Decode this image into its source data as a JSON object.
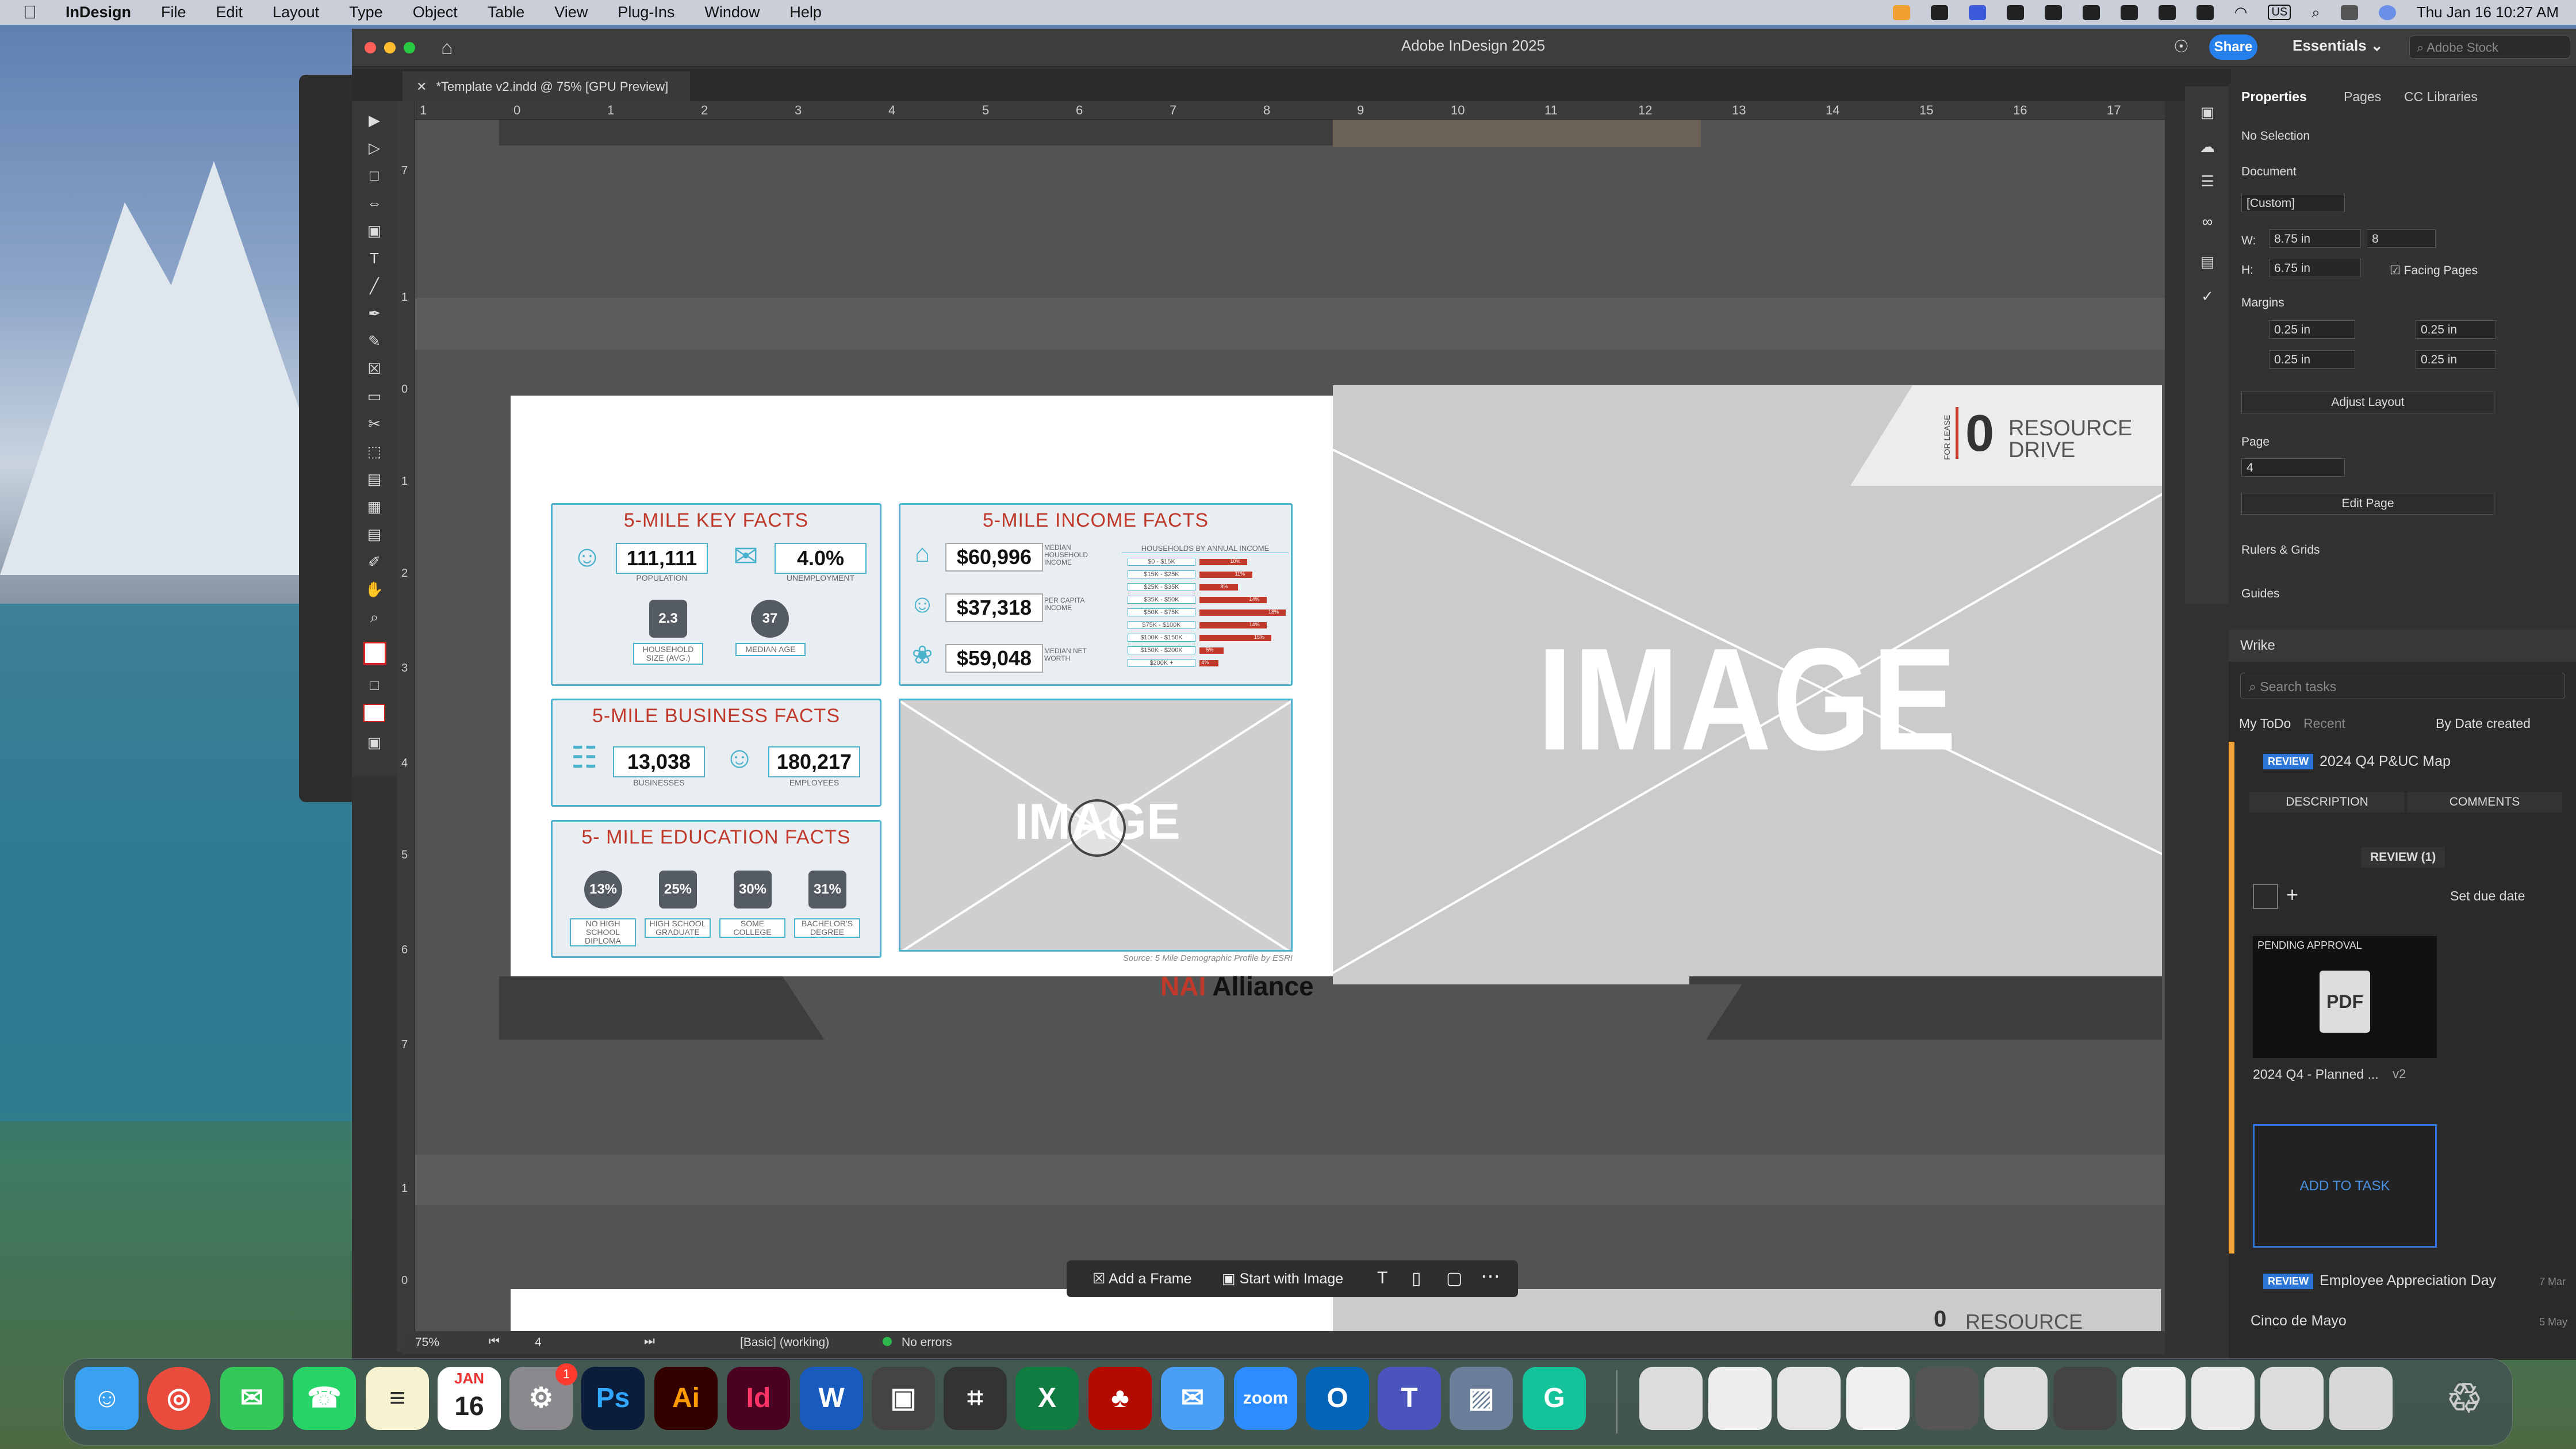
{
  "menubar": {
    "app": "InDesign",
    "items": [
      "File",
      "Edit",
      "Layout",
      "Type",
      "Object",
      "Table",
      "View",
      "Plug-Ins",
      "Window",
      "Help"
    ],
    "input_source": "US",
    "datetime": "Thu Jan 16  10:27 AM"
  },
  "window": {
    "title": "Adobe InDesign 2025",
    "share": "Share",
    "workspace": "Essentials",
    "search_placeholder": "Adobe Stock",
    "doc_tab": "*Template v2.indd @ 75% [GPU Preview]"
  },
  "ruler": {
    "h": [
      "1",
      "0",
      "1",
      "2",
      "3",
      "4",
      "5",
      "6",
      "7",
      "8",
      "9",
      "10",
      "11",
      "12",
      "13",
      "14",
      "15",
      "16",
      "17"
    ],
    "v": [
      "7",
      "1",
      "0",
      "1",
      "2",
      "3",
      "4",
      "5",
      "6",
      "7",
      "1",
      "0"
    ]
  },
  "key_facts": {
    "title": "5-MILE KEY FACTS",
    "population": "111,111",
    "population_label": "POPULATION",
    "unemployment": "4.0%",
    "unemployment_label": "UNEMPLOYMENT",
    "household": "2.3",
    "household_label": "HOUSEHOLD SIZE (AVG.)",
    "age": "37",
    "age_label": "MEDIAN AGE"
  },
  "income_facts": {
    "title": "5-MILE INCOME FACTS",
    "median_hh": "$60,996",
    "median_hh_label": "MEDIAN HOUSEHOLD INCOME",
    "per_capita": "$37,318",
    "per_capita_label": "PER CAPITA INCOME",
    "net_worth": "$59,048",
    "net_worth_label": "MEDIAN NET WORTH",
    "chart_title": "HOUSEHOLDS BY ANNUAL INCOME",
    "bands": [
      "$0 - $15K",
      "$15K - $25K",
      "$25K - $35K",
      "$35K - $50K",
      "$50K - $75K",
      "$75K - $100K",
      "$100K - $150K",
      "$150K - $200K",
      "$200K +"
    ],
    "pct": [
      "10%",
      "11%",
      "8%",
      "14%",
      "18%",
      "14%",
      "15%",
      "5%",
      "4%"
    ]
  },
  "business_facts": {
    "title": "5-MILE BUSINESS FACTS",
    "businesses": "13,038",
    "businesses_label": "BUSINESSES",
    "employees": "180,217",
    "employees_label": "EMPLOYEES"
  },
  "education_facts": {
    "title": "5- MILE EDUCATION FACTS",
    "items": [
      {
        "pct": "13%",
        "label": "NO HIGH SCHOOL DIPLOMA"
      },
      {
        "pct": "25%",
        "label": "HIGH SCHOOL GRADUATE"
      },
      {
        "pct": "30%",
        "label": "SOME COLLEGE"
      },
      {
        "pct": "31%",
        "label": "BACHELOR'S DEGREE"
      }
    ]
  },
  "image_placeholder": {
    "small": "IMAGE",
    "large": "IMAGE"
  },
  "source_note": "Source: 5 Mile Demographic Profile by ESRI",
  "brand": {
    "logo": "NAI",
    "name": "Alliance"
  },
  "cover": {
    "for_lease": "FOR LEASE",
    "number": "0",
    "street1": "RESOURCE",
    "street2": "DRIVE"
  },
  "properties": {
    "tabs": [
      "Properties",
      "Pages",
      "CC Libraries"
    ],
    "selection": "No Selection",
    "doc_label": "Document",
    "preset": "[Custom]",
    "w_label": "W:",
    "w": "8.75 in",
    "h_label": "H:",
    "h": "6.75 in",
    "pages": "8",
    "facing": "Facing Pages",
    "margins_label": "Margins",
    "m_top": "0.25 in",
    "m_bottom": "0.25 in",
    "m_left": "0.25 in",
    "m_right": "0.25 in",
    "adjust": "Adjust Layout",
    "page_label": "Page",
    "page": "4",
    "edit_page": "Edit Page",
    "rulers": "Rulers & Grids",
    "guides": "Guides"
  },
  "wrike": {
    "title": "Wrike",
    "search": "Search tasks",
    "tab1": "My ToDo",
    "tab2": "Recent",
    "sort": "By Date created",
    "task1_badge": "REVIEW",
    "task1": "2024 Q4 P&UC Map",
    "desc_btn": "DESCRIPTION",
    "comments_btn": "COMMENTS",
    "review_count": "REVIEW (1)",
    "due": "Set due date",
    "pending": "PENDING APPROVAL",
    "pdf": "PDF",
    "file": "2024 Q4 - Planned ...",
    "ver": "v2",
    "add": "ADD TO TASK",
    "task2_badge": "REVIEW",
    "task2": "Employee Appreciation Day",
    "task2_date": "7 Mar",
    "task3": "Cinco de Mayo",
    "task3_date": "5 May"
  },
  "status": {
    "zoom": "75%",
    "page": "4",
    "style": "[Basic] (working)",
    "errors": "No errors"
  },
  "floatbar": {
    "add_frame": "Add a Frame",
    "start_image": "Start with Image"
  },
  "dock": [
    "Finder",
    "Chrome",
    "Messages",
    "WhatsApp",
    "Notes",
    "Calendar",
    "Settings",
    "Photoshop",
    "Illustrator",
    "InDesign",
    "Word",
    "Screenshot",
    "Calculator",
    "Excel",
    "Acrobat",
    "Mail",
    "Zoom",
    "Outlook",
    "Teams",
    "Preview",
    "Grammarly"
  ],
  "calendar": {
    "month": "JAN",
    "day": "16"
  },
  "badge": "1"
}
